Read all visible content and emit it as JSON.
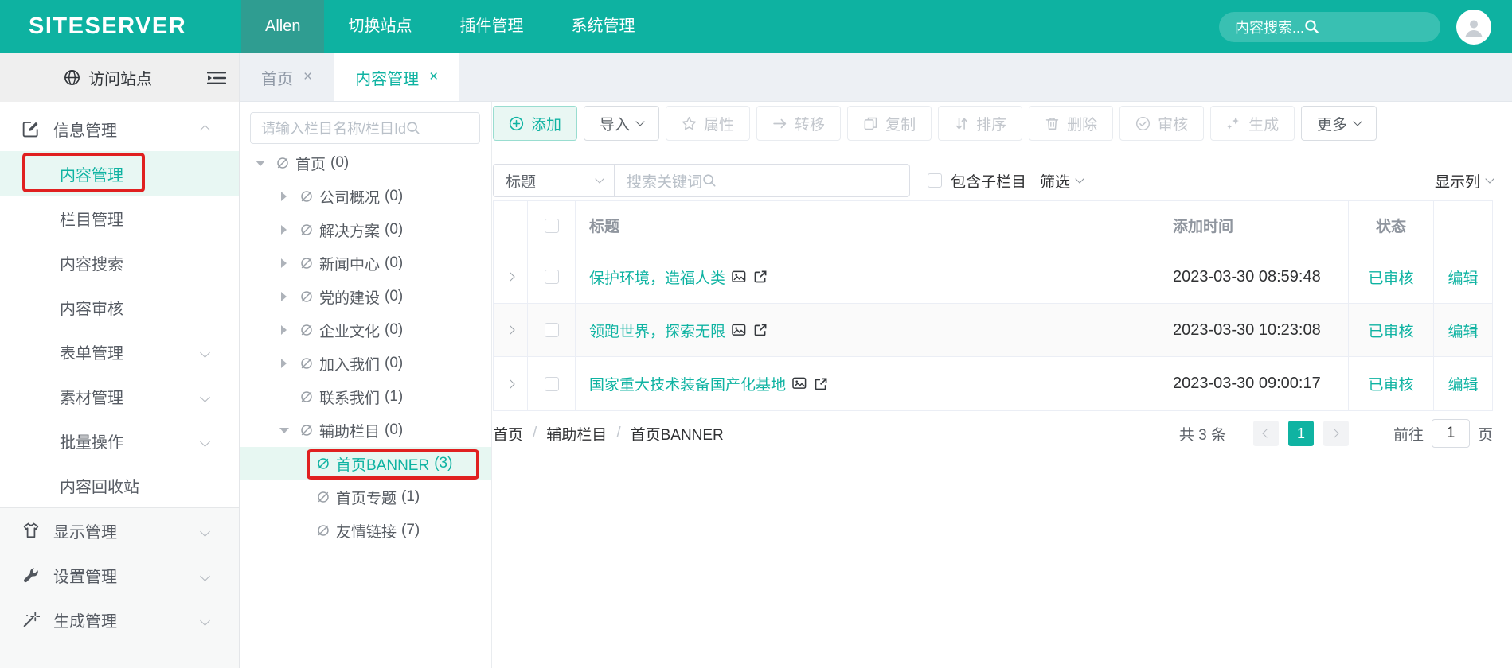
{
  "accent": "#0FB3A2",
  "annotation_color": "#E02020",
  "icons": {
    "close": "×",
    "breadcrumb_separator": "/"
  },
  "navbar": {
    "logo": "SITESERVER",
    "items": [
      {
        "label": "Allen"
      },
      {
        "label": "切换站点"
      },
      {
        "label": "插件管理"
      },
      {
        "label": "系统管理"
      }
    ],
    "search_placeholder": "内容搜索..."
  },
  "sidebar": {
    "visit_site": "访问站点",
    "items": [
      {
        "label": "信息管理"
      },
      {
        "label": "内容管理"
      },
      {
        "label": "栏目管理"
      },
      {
        "label": "内容搜索"
      },
      {
        "label": "内容审核"
      },
      {
        "label": "表单管理"
      },
      {
        "label": "素材管理"
      },
      {
        "label": "批量操作"
      },
      {
        "label": "内容回收站"
      },
      {
        "label": "显示管理"
      },
      {
        "label": "设置管理"
      },
      {
        "label": "生成管理"
      }
    ]
  },
  "tabs": [
    {
      "label": "首页"
    },
    {
      "label": "内容管理"
    }
  ],
  "tree": {
    "search_placeholder": "请输入栏目名称/栏目Id",
    "items": [
      {
        "label": "首页",
        "count": "(0)"
      },
      {
        "label": "公司概况",
        "count": "(0)"
      },
      {
        "label": "解决方案",
        "count": "(0)"
      },
      {
        "label": "新闻中心",
        "count": "(0)"
      },
      {
        "label": "党的建设",
        "count": "(0)"
      },
      {
        "label": "企业文化",
        "count": "(0)"
      },
      {
        "label": "加入我们",
        "count": "(0)"
      },
      {
        "label": "联系我们",
        "count": "(1)"
      },
      {
        "label": "辅助栏目",
        "count": "(0)"
      },
      {
        "label": "首页BANNER",
        "count": "(3)"
      },
      {
        "label": "首页专题",
        "count": "(1)"
      },
      {
        "label": "友情链接",
        "count": "(7)"
      }
    ]
  },
  "toolbar": {
    "add": "添加",
    "import": "导入",
    "attrs": "属性",
    "transfer": "转移",
    "copy": "复制",
    "sort": "排序",
    "delete": "删除",
    "review": "审核",
    "generate": "生成",
    "more": "更多"
  },
  "filters": {
    "field_select": "标题",
    "keyword_placeholder": "搜索关键词",
    "include_children": "包含子栏目",
    "filter_label": "筛选",
    "columns_label": "显示列"
  },
  "table": {
    "headers": {
      "title": "标题",
      "time": "添加时间",
      "status": "状态"
    },
    "rows": [
      {
        "title": "保护环境，造福人类",
        "time": "2023-03-30 08:59:48",
        "status": "已审核",
        "action": "编辑"
      },
      {
        "title": "领跑世界，探索无限",
        "time": "2023-03-30 10:23:08",
        "status": "已审核",
        "action": "编辑"
      },
      {
        "title": "国家重大技术装备国产化基地",
        "time": "2023-03-30 09:00:17",
        "status": "已审核",
        "action": "编辑"
      }
    ]
  },
  "breadcrumb": {
    "items": [
      "首页",
      "辅助栏目",
      "首页BANNER"
    ]
  },
  "pagination": {
    "total": "共 3 条",
    "page": "1",
    "goto_label": "前往",
    "goto_value": "1",
    "page_unit": "页"
  }
}
